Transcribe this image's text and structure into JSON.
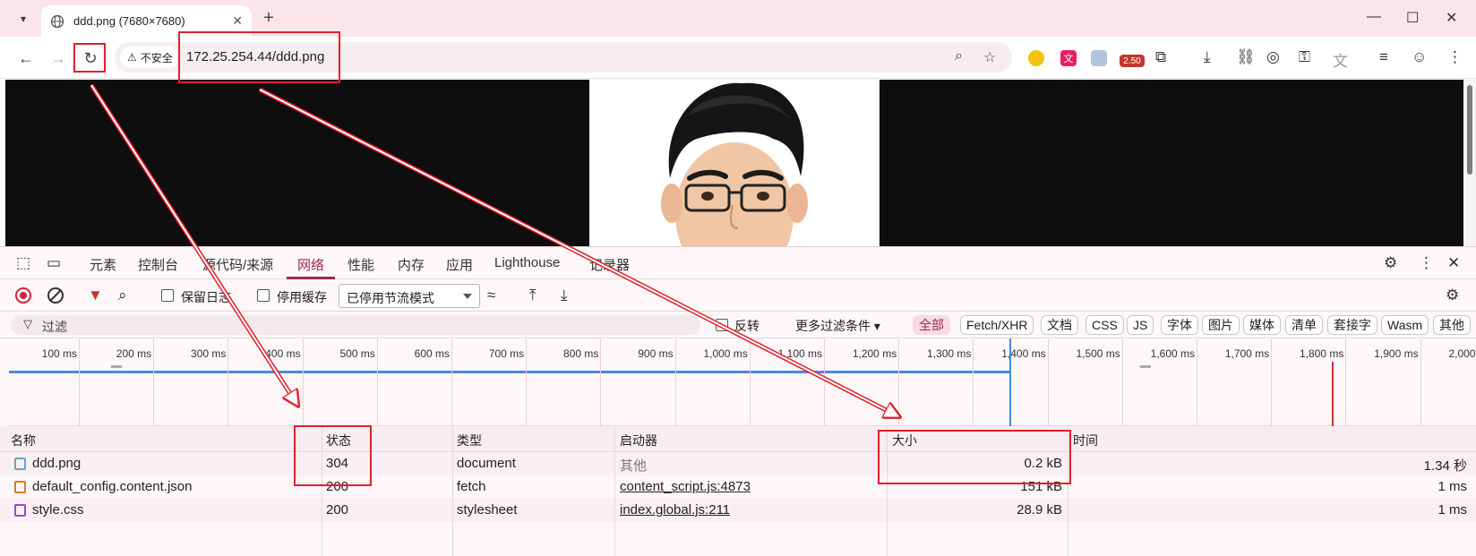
{
  "browser": {
    "tab_title": "ddd.png (7680×7680)",
    "security_label": "不安全",
    "url": "172.25.254.44/ddd.png",
    "extension_badge": "2.50"
  },
  "devtools": {
    "tabs": [
      {
        "label": "元素"
      },
      {
        "label": "控制台"
      },
      {
        "label": "源代码/来源"
      },
      {
        "label": "网络"
      },
      {
        "label": "性能"
      },
      {
        "label": "内存"
      },
      {
        "label": "应用"
      },
      {
        "label": "Lighthouse"
      },
      {
        "label": "记录器"
      }
    ],
    "active_tab": "网络",
    "controls": {
      "preserve_log": "保留日志",
      "disable_cache": "停用缓存",
      "throttling": "已停用节流模式"
    },
    "filter": {
      "placeholder": "过滤",
      "invert": "反转",
      "more_filters": "更多过滤条件",
      "types": [
        "全部",
        "Fetch/XHR",
        "文档",
        "CSS",
        "JS",
        "字体",
        "图片",
        "媒体",
        "清单",
        "套接字",
        "Wasm",
        "其他"
      ],
      "active_type": "全部"
    },
    "timeline_ticks": [
      "100 ms",
      "200 ms",
      "300 ms",
      "400 ms",
      "500 ms",
      "600 ms",
      "700 ms",
      "800 ms",
      "900 ms",
      "1,000 ms",
      "1,100 ms",
      "1,200 ms",
      "1,300 ms",
      "1,400 ms",
      "1,500 ms",
      "1,600 ms",
      "1,700 ms",
      "1,800 ms",
      "1,900 ms",
      "2,000 ms"
    ],
    "columns": {
      "name": "名称",
      "status": "状态",
      "type": "类型",
      "initiator": "启动器",
      "size": "大小",
      "time": "时间"
    },
    "rows": [
      {
        "name": "ddd.png",
        "status": "304",
        "type": "document",
        "initiator": "其他",
        "size": "0.2 kB",
        "time": "1.34 秒",
        "icon_color": "#6aa0c9"
      },
      {
        "name": "default_config.content.json",
        "status": "200",
        "type": "fetch",
        "initiator": "content_script.js:4873",
        "size": "151 kB",
        "time": "1 ms",
        "icon_color": "#e07b1a"
      },
      {
        "name": "style.css",
        "status": "200",
        "type": "stylesheet",
        "initiator": "index.global.js:211",
        "size": "28.9 kB",
        "time": "1 ms",
        "icon_color": "#8a4fd1"
      }
    ]
  }
}
